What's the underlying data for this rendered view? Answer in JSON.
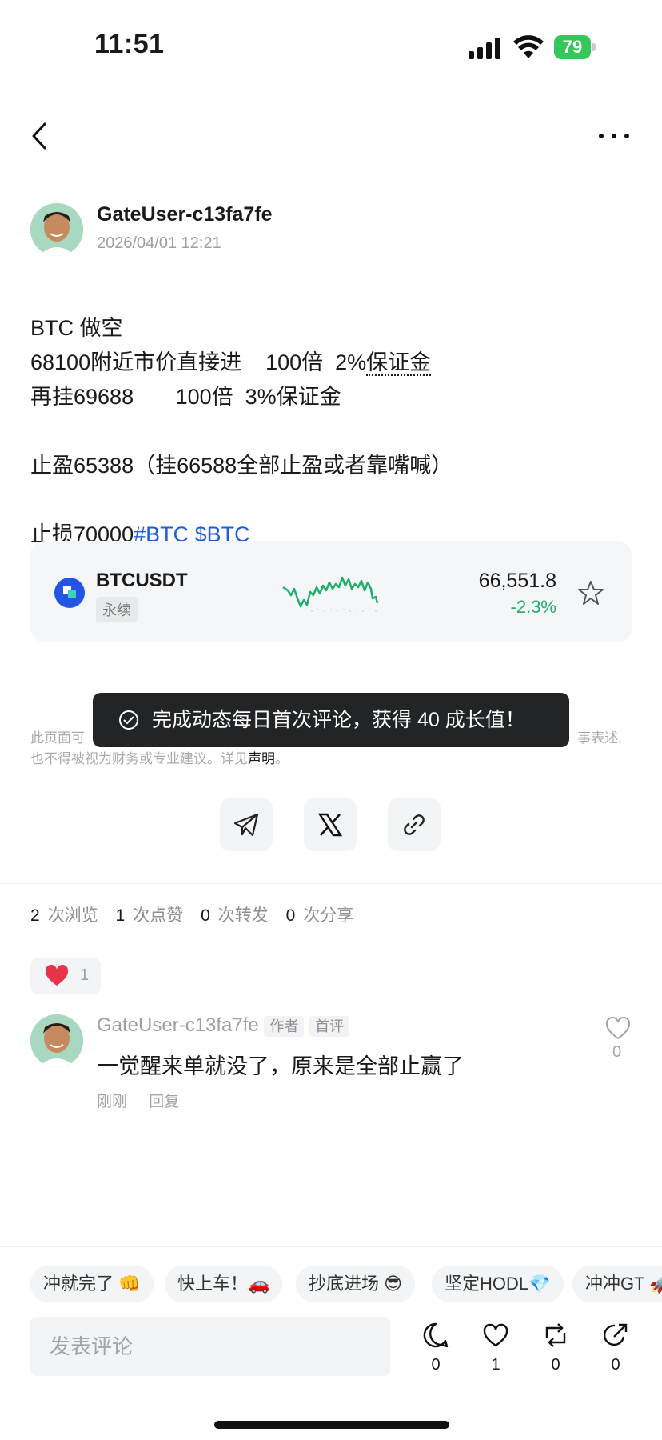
{
  "status_bar": {
    "time": "11:51",
    "battery": "79"
  },
  "header": {
    "back_icon": "chevron-left-icon",
    "more_icon": "more-dots-icon"
  },
  "post": {
    "username": "GateUser-c13fa7fe",
    "date": "2026/04/01 12:21",
    "line1": "BTC 做空",
    "line2_prefix": "68100附近市价直接进    100倍  2%",
    "line2_underlined": "保证金",
    "line3": "再挂69688       100倍  3%保证金",
    "line4": "止盈65388（挂66588全部止盈或者靠嘴喊）",
    "line5_prefix": "止损70000",
    "line5_tags": "#BTC $BTC"
  },
  "ticker_card": {
    "symbol": "BTCUSDT",
    "type_label": "永续",
    "price": "66,551.8",
    "change": "-2.3%",
    "up_color": "#1fae6c"
  },
  "toast": {
    "text": "完成动态每日首次评论，获得 40 成长值！"
  },
  "disclaimer": {
    "left_visible": "此页面可",
    "right_visible": "事表述,",
    "line2": "也不得被视为财务或专业建议。详见",
    "link": "声明",
    "end": "。"
  },
  "share": [
    "telegram-icon",
    "x-icon",
    "link-icon"
  ],
  "stats": [
    {
      "count": "2",
      "label": "次浏览"
    },
    {
      "count": "1",
      "label": "次点赞"
    },
    {
      "count": "0",
      "label": "次转发"
    },
    {
      "count": "0",
      "label": "次分享"
    }
  ],
  "reaction": {
    "icon": "heart-icon",
    "count": "1"
  },
  "comment": {
    "username": "GateUser-c13fa7fe",
    "badges": [
      "作者",
      "首评"
    ],
    "text": "一觉醒来单就没了，原来是全部止赢了",
    "time": "刚刚",
    "reply": "回复",
    "like_count": "0"
  },
  "quick_replies": [
    "冲就完了 👊",
    "快上车！🚗",
    "抄底进场 😎",
    "坚定HODL💎",
    "冲冲GT 🚀"
  ],
  "composer": {
    "placeholder": "发表评论",
    "actions": [
      {
        "icon": "comment-icon",
        "count": "0"
      },
      {
        "icon": "heart-outline-icon",
        "count": "1"
      },
      {
        "icon": "repost-icon",
        "count": "0"
      },
      {
        "icon": "share-icon",
        "count": "0"
      }
    ]
  }
}
